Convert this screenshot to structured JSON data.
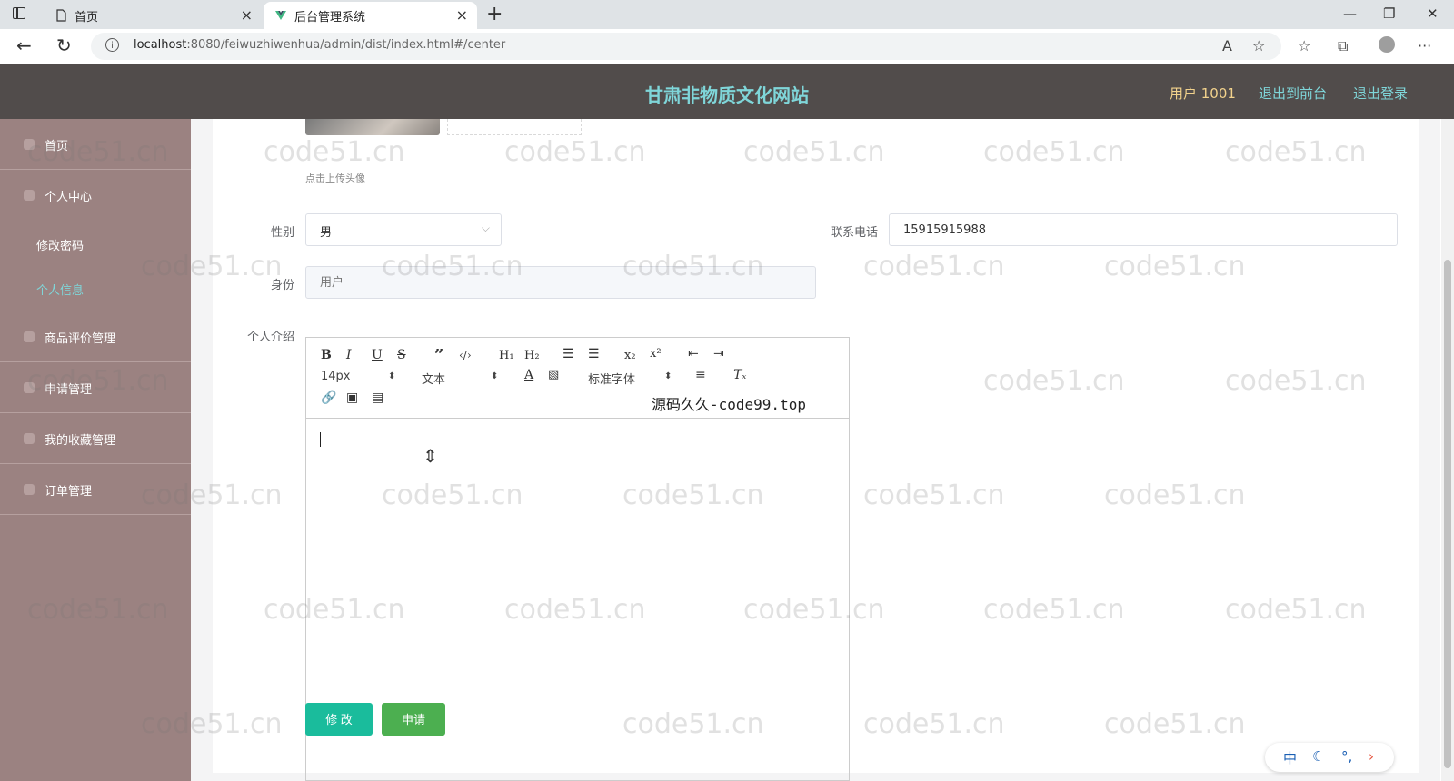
{
  "browser": {
    "tabs": [
      {
        "label": "首页"
      },
      {
        "label": "后台管理系统"
      }
    ],
    "url_host": "localhost",
    "url_path": ":8080/feiwuzhiwenhua/admin/dist/index.html#/center"
  },
  "header": {
    "title": "甘肃非物质文化网站",
    "user_label": "用户 1001",
    "front_label": "退出到前台",
    "logout_label": "退出登录"
  },
  "sidebar": {
    "items": [
      {
        "label": "首页"
      },
      {
        "label": "个人中心"
      },
      {
        "label": "商品评价管理"
      },
      {
        "label": "申请管理"
      },
      {
        "label": "我的收藏管理"
      },
      {
        "label": "订单管理"
      }
    ],
    "submenu": [
      {
        "label": "修改密码"
      },
      {
        "label": "个人信息"
      }
    ]
  },
  "form": {
    "avatar_hint": "点击上传头像",
    "gender_label": "性别",
    "gender_value": "男",
    "phone_label": "联系电话",
    "phone_value": "15915915988",
    "identity_label": "身份",
    "identity_placeholder": "用户",
    "intro_label": "个人介绍",
    "modify_button": "修 改",
    "apply_button": "申请"
  },
  "editor": {
    "font_size": "14px",
    "block_format": "文本",
    "font_family": "标准字体",
    "note": "源码久久-code99.top"
  },
  "ime": {
    "mode": "中"
  },
  "watermark": "code51.cn"
}
